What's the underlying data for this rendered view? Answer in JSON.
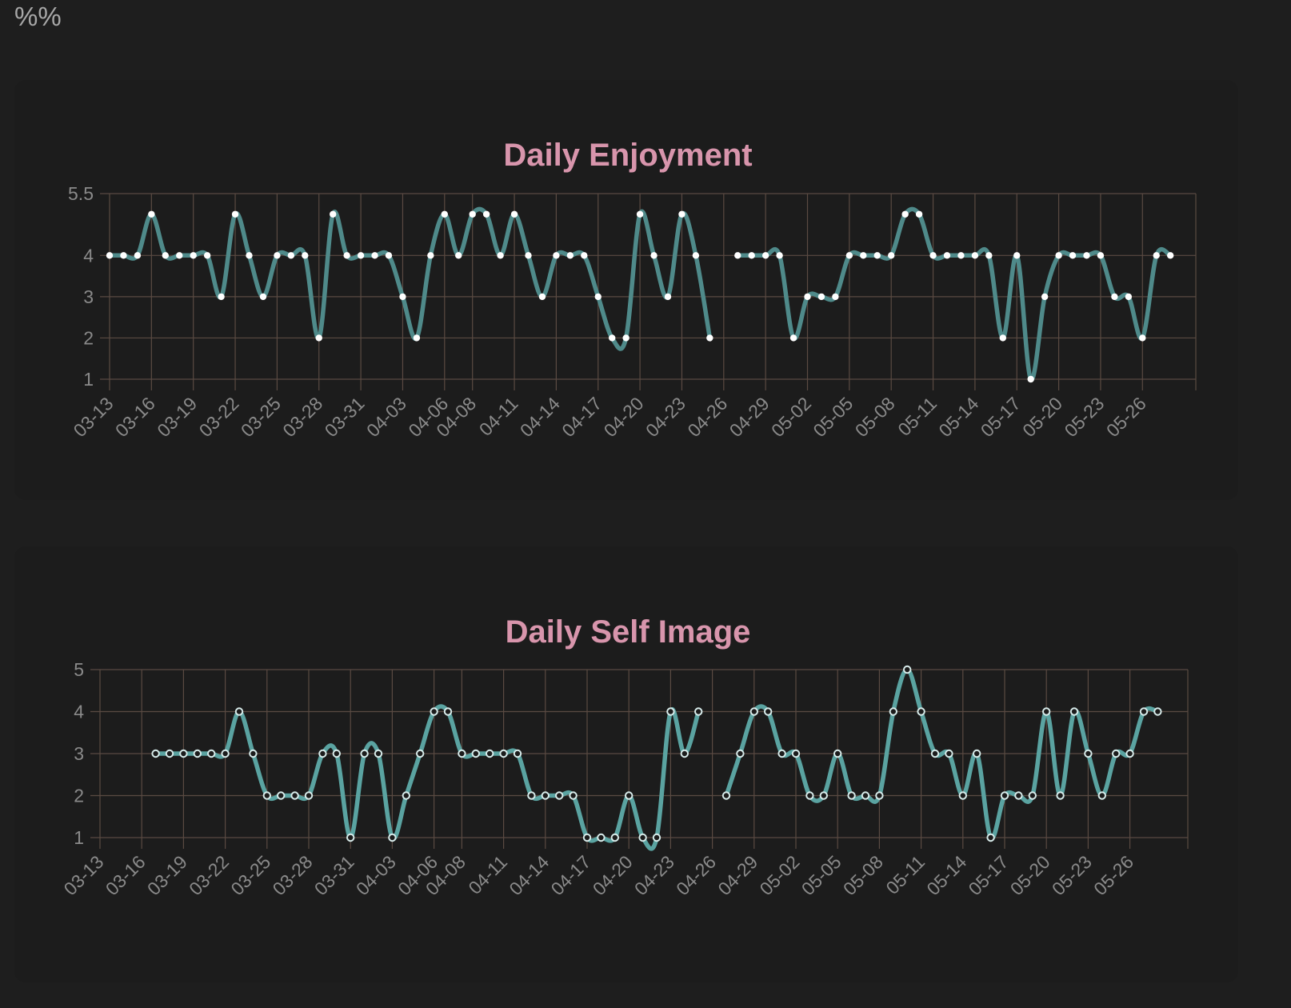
{
  "page": {
    "header_text": "%%"
  },
  "colors": {
    "background": "#1e1e1e",
    "card": "#1c1c1c",
    "title": "#d895ac",
    "grid": "#5a4a42",
    "line_enjoyment": "#4f8a8a",
    "line_self_image": "#5aa3a1",
    "tick_text": "#8a8a8a",
    "marker_fill": "#ffffff",
    "marker_hollow_fill": "#1c1c1c"
  },
  "chart_data": [
    {
      "id": "enjoyment",
      "type": "line",
      "title": "Daily Enjoyment",
      "xlabel": "",
      "ylabel": "",
      "x_start": "03-13",
      "x_ticks": [
        "03-13",
        "03-16",
        "03-19",
        "03-22",
        "03-25",
        "03-28",
        "03-31",
        "04-03",
        "04-06",
        "04-08",
        "04-11",
        "04-14",
        "04-17",
        "04-20",
        "04-23",
        "04-26",
        "04-29",
        "05-02",
        "05-05",
        "05-08",
        "05-11",
        "05-14",
        "05-17",
        "05-20",
        "05-23",
        "05-26"
      ],
      "y_ticks": [
        "1",
        "2",
        "3",
        "4",
        "5.5"
      ],
      "ylim": [
        1,
        5.5
      ],
      "grid": true,
      "marker": "filled",
      "series": [
        {
          "values": [
            [
              "03-13",
              4
            ],
            [
              "03-14",
              4
            ],
            [
              "03-15",
              4
            ],
            [
              "03-16",
              5
            ],
            [
              "03-17",
              4
            ],
            [
              "03-18",
              4
            ],
            [
              "03-19",
              4
            ],
            [
              "03-20",
              4
            ],
            [
              "03-21",
              3
            ],
            [
              "03-22",
              5
            ],
            [
              "03-23",
              4
            ],
            [
              "03-24",
              3
            ],
            [
              "03-25",
              4
            ],
            [
              "03-26",
              4
            ],
            [
              "03-27",
              4
            ],
            [
              "03-28",
              2
            ],
            [
              "03-29",
              5
            ],
            [
              "03-30",
              4
            ],
            [
              "03-31",
              4
            ],
            [
              "04-01",
              4
            ],
            [
              "04-02",
              4
            ],
            [
              "04-03",
              3
            ],
            [
              "04-04",
              2
            ],
            [
              "04-05",
              4
            ],
            [
              "04-06",
              5
            ],
            [
              "04-07",
              4
            ],
            [
              "04-08",
              5
            ],
            [
              "04-09",
              5
            ],
            [
              "04-10",
              4
            ],
            [
              "04-11",
              5
            ],
            [
              "04-12",
              4
            ],
            [
              "04-13",
              3
            ],
            [
              "04-14",
              4
            ],
            [
              "04-15",
              4
            ],
            [
              "04-16",
              4
            ],
            [
              "04-17",
              3
            ],
            [
              "04-18",
              2
            ],
            [
              "04-19",
              2
            ],
            [
              "04-20",
              5
            ],
            [
              "04-21",
              4
            ],
            [
              "04-22",
              3
            ],
            [
              "04-23",
              5
            ],
            [
              "04-24",
              4
            ],
            [
              "04-25",
              2
            ],
            null,
            [
              "04-27",
              4
            ],
            [
              "04-28",
              4
            ],
            [
              "04-29",
              4
            ],
            [
              "04-30",
              4
            ],
            [
              "05-01",
              2
            ],
            [
              "05-02",
              3
            ],
            [
              "05-03",
              3
            ],
            [
              "05-04",
              3
            ],
            [
              "05-05",
              4
            ],
            [
              "05-06",
              4
            ],
            [
              "05-07",
              4
            ],
            [
              "05-08",
              4
            ],
            [
              "05-09",
              5
            ],
            [
              "05-10",
              5
            ],
            [
              "05-11",
              4
            ],
            [
              "05-12",
              4
            ],
            [
              "05-13",
              4
            ],
            [
              "05-14",
              4
            ],
            [
              "05-15",
              4
            ],
            [
              "05-16",
              2
            ],
            [
              "05-17",
              4
            ],
            [
              "05-18",
              1
            ],
            [
              "05-19",
              3
            ],
            [
              "05-20",
              4
            ],
            [
              "05-21",
              4
            ],
            [
              "05-22",
              4
            ],
            [
              "05-23",
              4
            ],
            [
              "05-24",
              3
            ],
            [
              "05-25",
              3
            ],
            [
              "05-26",
              2
            ],
            [
              "05-27",
              4
            ],
            [
              "05-28",
              4
            ]
          ]
        }
      ]
    },
    {
      "id": "self_image",
      "type": "line",
      "title": "Daily Self Image",
      "xlabel": "",
      "ylabel": "",
      "x_start": "03-13",
      "x_ticks": [
        "03-13",
        "03-16",
        "03-19",
        "03-22",
        "03-25",
        "03-28",
        "03-31",
        "04-03",
        "04-06",
        "04-08",
        "04-11",
        "04-14",
        "04-17",
        "04-20",
        "04-23",
        "04-26",
        "04-29",
        "05-02",
        "05-05",
        "05-08",
        "05-11",
        "05-14",
        "05-17",
        "05-20",
        "05-23",
        "05-26"
      ],
      "y_ticks": [
        "1",
        "2",
        "3",
        "4",
        "5"
      ],
      "ylim": [
        1,
        5
      ],
      "grid": true,
      "marker": "hollow",
      "series": [
        {
          "values": [
            [
              "03-17",
              3
            ],
            [
              "03-18",
              3
            ],
            [
              "03-19",
              3
            ],
            [
              "03-20",
              3
            ],
            [
              "03-21",
              3
            ],
            [
              "03-22",
              3
            ],
            [
              "03-23",
              4
            ],
            [
              "03-24",
              3
            ],
            [
              "03-25",
              2
            ],
            [
              "03-26",
              2
            ],
            [
              "03-27",
              2
            ],
            [
              "03-28",
              2
            ],
            [
              "03-29",
              3
            ],
            [
              "03-30",
              3
            ],
            [
              "03-31",
              1
            ],
            [
              "04-01",
              3
            ],
            [
              "04-02",
              3
            ],
            [
              "04-03",
              1
            ],
            [
              "04-04",
              2
            ],
            [
              "04-05",
              3
            ],
            [
              "04-06",
              4
            ],
            [
              "04-07",
              4
            ],
            [
              "04-08",
              3
            ],
            [
              "04-09",
              3
            ],
            [
              "04-10",
              3
            ],
            [
              "04-11",
              3
            ],
            [
              "04-12",
              3
            ],
            [
              "04-13",
              2
            ],
            [
              "04-14",
              2
            ],
            [
              "04-15",
              2
            ],
            [
              "04-16",
              2
            ],
            [
              "04-17",
              1
            ],
            [
              "04-18",
              1
            ],
            [
              "04-19",
              1
            ],
            [
              "04-20",
              2
            ],
            [
              "04-21",
              1
            ],
            [
              "04-22",
              1
            ],
            [
              "04-23",
              4
            ],
            [
              "04-24",
              3
            ],
            [
              "04-25",
              4
            ],
            null,
            [
              "04-27",
              2
            ],
            [
              "04-28",
              3
            ],
            [
              "04-29",
              4
            ],
            [
              "04-30",
              4
            ],
            [
              "05-01",
              3
            ],
            [
              "05-02",
              3
            ],
            [
              "05-03",
              2
            ],
            [
              "05-04",
              2
            ],
            [
              "05-05",
              3
            ],
            [
              "05-06",
              2
            ],
            [
              "05-07",
              2
            ],
            [
              "05-08",
              2
            ],
            [
              "05-09",
              4
            ],
            [
              "05-10",
              5
            ],
            [
              "05-11",
              4
            ],
            [
              "05-12",
              3
            ],
            [
              "05-13",
              3
            ],
            [
              "05-14",
              2
            ],
            [
              "05-15",
              3
            ],
            [
              "05-16",
              1
            ],
            [
              "05-17",
              2
            ],
            [
              "05-18",
              2
            ],
            [
              "05-19",
              2
            ],
            [
              "05-20",
              4
            ],
            [
              "05-21",
              2
            ],
            [
              "05-22",
              4
            ],
            [
              "05-23",
              3
            ],
            [
              "05-24",
              2
            ],
            [
              "05-25",
              3
            ],
            [
              "05-26",
              3
            ],
            [
              "05-27",
              4
            ],
            [
              "05-28",
              4
            ]
          ]
        }
      ]
    }
  ]
}
